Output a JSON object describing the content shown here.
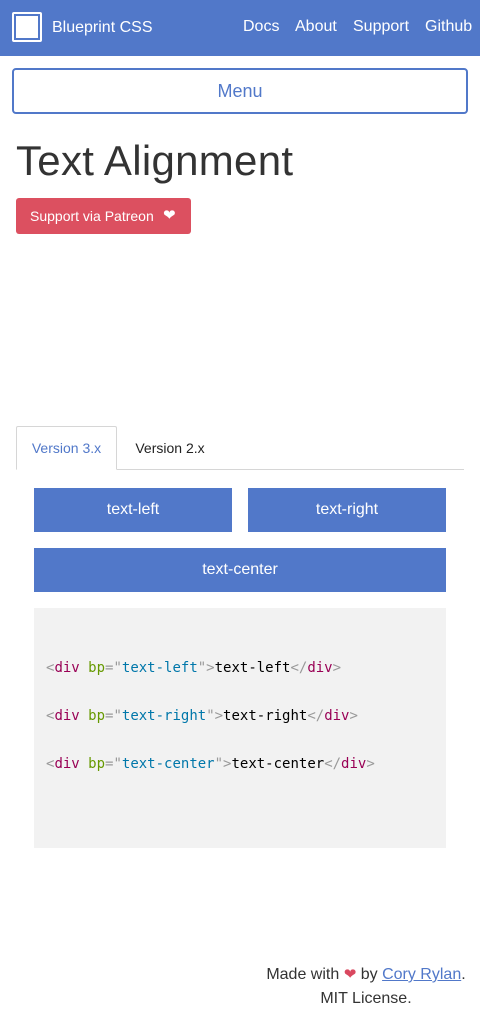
{
  "header": {
    "brand": "Blueprint CSS",
    "nav": [
      "Docs",
      "About",
      "Support",
      "Github"
    ],
    "menu_label": "Menu"
  },
  "page": {
    "title": "Text Alignment",
    "patreon_label": "Support via Patreon",
    "patreon_icon": "heart-icon"
  },
  "tabs": [
    {
      "label": "Version 3.x",
      "active": true
    },
    {
      "label": "Version 2.x",
      "active": false
    }
  ],
  "demo": {
    "left": "text-left",
    "right": "text-right",
    "center": "text-center"
  },
  "code": {
    "tag": "div",
    "attr": "bp",
    "lines": [
      {
        "value": "text-left",
        "content": "text-left"
      },
      {
        "value": "text-right",
        "content": "text-right"
      },
      {
        "value": "text-center",
        "content": "text-center"
      }
    ]
  },
  "footer": {
    "made_with": "Made with",
    "by": "by",
    "author": "Cory Rylan",
    "license": ". MIT License."
  },
  "colors": {
    "primary": "#5178c9",
    "patreon": "#dc5060",
    "code_bg": "#f2f2f2"
  }
}
